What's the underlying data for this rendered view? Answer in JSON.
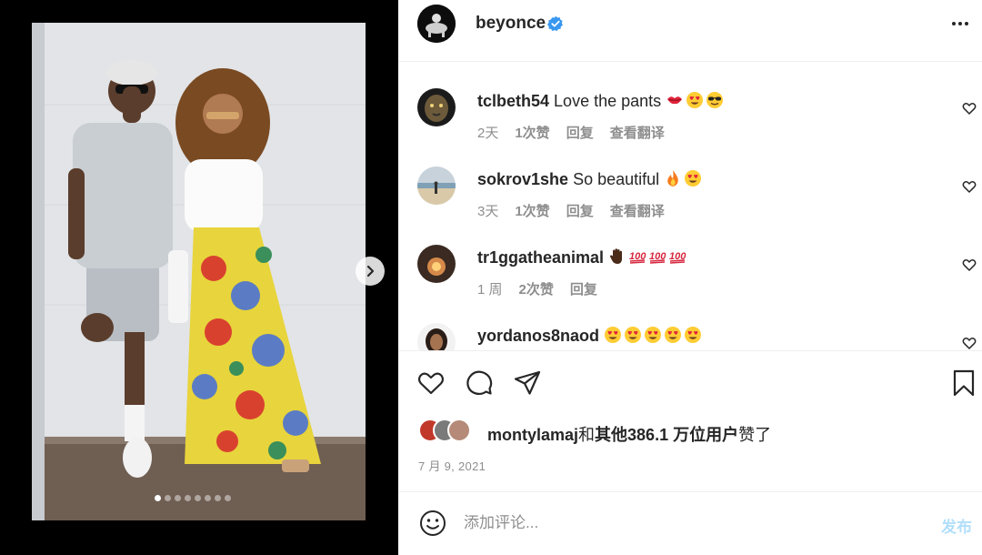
{
  "post": {
    "username": "beyonce",
    "more_icon": "more-horizontal-icon",
    "verified_icon": "verified-badge-icon"
  },
  "media": {
    "slide_count": 8,
    "active_slide": 1,
    "next_icon": "chevron-right-icon"
  },
  "comments": [
    {
      "user": "tclbeth54",
      "text": "Love the pants",
      "emojis": [
        "lips",
        "heart-eyes",
        "sunglasses"
      ],
      "time": "2天",
      "likes": "1次赞",
      "reply": "回复",
      "translate": "查看翻译"
    },
    {
      "user": "sokrov1she",
      "text": "So beautiful",
      "emojis": [
        "fire",
        "heart-eyes"
      ],
      "time": "3天",
      "likes": "1次赞",
      "reply": "回复",
      "translate": "查看翻译"
    },
    {
      "user": "tr1ggatheanimal",
      "text": "",
      "emojis": [
        "raised-hand",
        "hundred",
        "hundred",
        "hundred"
      ],
      "time": "1 周",
      "likes": "2次赞",
      "reply": "回复",
      "translate": ""
    },
    {
      "user": "yordanos8naod",
      "text": "",
      "emojis": [
        "heart-eyes",
        "heart-eyes",
        "heart-eyes",
        "heart-eyes",
        "heart-eyes"
      ],
      "time": "",
      "likes": "",
      "reply": "",
      "translate": ""
    }
  ],
  "actions": {
    "like_icon": "heart-icon",
    "comment_icon": "comment-bubble-icon",
    "share_icon": "paper-plane-icon",
    "save_icon": "bookmark-icon"
  },
  "likes": {
    "user": "montylamaj",
    "joiner": "和",
    "others": "其他",
    "count": "386.1 万位用户",
    "suffix": "赞了"
  },
  "date": "7 月 9, 2021",
  "composer": {
    "placeholder": "添加评论...",
    "post_label": "发布",
    "emoji_icon": "smiley-icon"
  },
  "colors": {
    "verified": "#3897f0",
    "post_disabled": "#b2dffc",
    "meta_text": "#8e8e8e"
  }
}
